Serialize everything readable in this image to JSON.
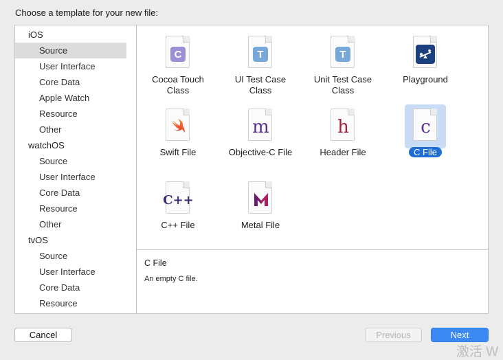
{
  "dialog": {
    "prompt": "Choose a template for your new file:"
  },
  "sidebar": {
    "groups": [
      {
        "name": "iOS",
        "items": [
          "Source",
          "User Interface",
          "Core Data",
          "Apple Watch",
          "Resource",
          "Other"
        ]
      },
      {
        "name": "watchOS",
        "items": [
          "Source",
          "User Interface",
          "Core Data",
          "Resource",
          "Other"
        ]
      },
      {
        "name": "tvOS",
        "items": [
          "Source",
          "User Interface",
          "Core Data",
          "Resource"
        ]
      }
    ],
    "selected": "iOS / Source"
  },
  "templates": [
    {
      "label": "Cocoa Touch Class",
      "line1": "Cocoa Touch",
      "line2": "Class",
      "icon": "cocoa-touch-class-icon",
      "glyph": "C",
      "color": "#9b8fd6"
    },
    {
      "label": "UI Test Case Class",
      "line1": "UI Test Case",
      "line2": "Class",
      "icon": "ui-test-case-class-icon",
      "glyph": "T",
      "color": "#78a8d8"
    },
    {
      "label": "Unit Test Case Class",
      "line1": "Unit Test Case",
      "line2": "Class",
      "icon": "unit-test-case-class-icon",
      "glyph": "T",
      "color": "#78a8d8"
    },
    {
      "label": "Playground",
      "line1": "Playground",
      "line2": "",
      "icon": "playground-icon",
      "glyph": "",
      "color": "#1b3f7f"
    },
    {
      "label": "Swift File",
      "line1": "Swift File",
      "line2": "",
      "icon": "swift-file-icon",
      "glyph": "",
      "color": "#f05138"
    },
    {
      "label": "Objective-C File",
      "line1": "Objective-C File",
      "line2": "",
      "icon": "objective-c-file-icon",
      "glyph": "m",
      "color": "#5c2f8f"
    },
    {
      "label": "Header File",
      "line1": "Header File",
      "line2": "",
      "icon": "header-file-icon",
      "glyph": "h",
      "color": "#a3213d"
    },
    {
      "label": "C File",
      "line1": "C File",
      "line2": "",
      "icon": "c-file-icon",
      "glyph": "c",
      "color": "#5c2f8f",
      "selected": true
    },
    {
      "label": "C++ File",
      "line1": "C++ File",
      "line2": "",
      "icon": "cpp-file-icon",
      "glyph": "C++",
      "color": "#3b2a78"
    },
    {
      "label": "Metal File",
      "line1": "Metal File",
      "line2": "",
      "icon": "metal-file-icon",
      "glyph": "M",
      "color": "#b0205f"
    }
  ],
  "description": {
    "title": "C File",
    "body": "An empty C file."
  },
  "buttons": {
    "cancel": "Cancel",
    "previous": "Previous",
    "next": "Next"
  },
  "watermark": "激活 W"
}
